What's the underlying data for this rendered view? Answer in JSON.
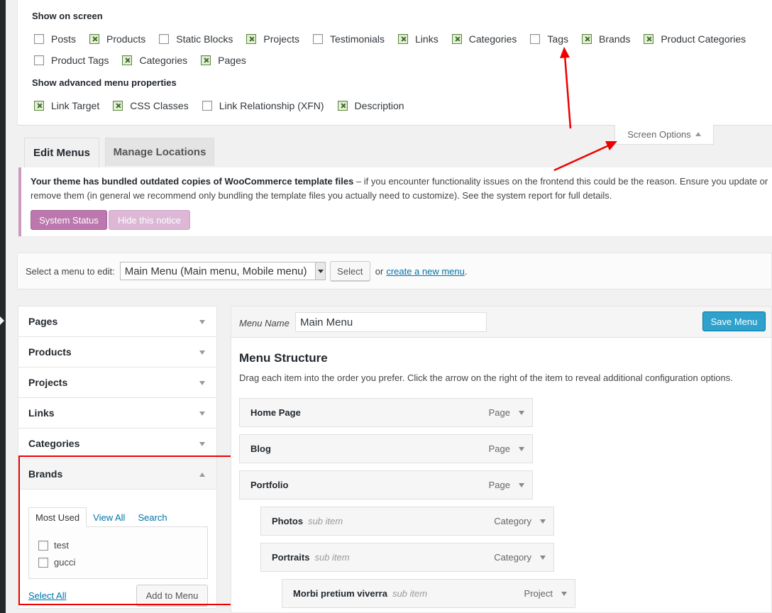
{
  "screen_options": {
    "show_on_screen_heading": "Show on screen",
    "items": [
      {
        "label": "Posts",
        "checked": false
      },
      {
        "label": "Products",
        "checked": true
      },
      {
        "label": "Static Blocks",
        "checked": false
      },
      {
        "label": "Projects",
        "checked": true
      },
      {
        "label": "Testimonials",
        "checked": false
      },
      {
        "label": "Links",
        "checked": true
      },
      {
        "label": "Categories",
        "checked": true
      },
      {
        "label": "Tags",
        "checked": false
      },
      {
        "label": "Brands",
        "checked": true
      },
      {
        "label": "Product Categories",
        "checked": true
      },
      {
        "label": "Product Tags",
        "checked": false
      },
      {
        "label": "Categories",
        "checked": true
      },
      {
        "label": "Pages",
        "checked": true
      }
    ],
    "advanced_heading": "Show advanced menu properties",
    "advanced_items": [
      {
        "label": "Link Target",
        "checked": true
      },
      {
        "label": "CSS Classes",
        "checked": true
      },
      {
        "label": "Link Relationship (XFN)",
        "checked": false
      },
      {
        "label": "Description",
        "checked": true
      }
    ],
    "tab_label": "Screen Options"
  },
  "nav_tabs": {
    "edit_menus": "Edit Menus",
    "manage_locations": "Manage Locations"
  },
  "notice": {
    "bold_text": "Your theme has bundled outdated copies of WooCommerce template files",
    "rest_text": " – if you encounter functionality issues on the frontend this could be the reason. Ensure you update or remove them (in general we recommend only bundling the template files you actually need to customize). See the system report for full details.",
    "system_status_button": "System Status",
    "hide_notice_button": "Hide this notice"
  },
  "manage_menus": {
    "label": "Select a menu to edit:",
    "selected_menu": "Main Menu (Main menu, Mobile menu)",
    "select_button": "Select",
    "or_text": "or",
    "create_link": "create a new menu",
    "period": "."
  },
  "accordion": {
    "sections": [
      "Pages",
      "Products",
      "Projects",
      "Links",
      "Categories"
    ],
    "brands": {
      "title": "Brands",
      "tabs": [
        "Most Used",
        "View All",
        "Search"
      ],
      "items": [
        "test",
        "gucci"
      ],
      "select_all": "Select All",
      "add_button": "Add to Menu"
    }
  },
  "editor": {
    "menu_name_label": "Menu Name",
    "menu_name_value": "Main Menu",
    "save_button": "Save Menu",
    "structure_title": "Menu Structure",
    "structure_desc": "Drag each item into the order you prefer. Click the arrow on the right of the item to reveal additional configuration options.",
    "items": [
      {
        "title": "Home Page",
        "sub": "",
        "type": "Page",
        "depth": 0
      },
      {
        "title": "Blog",
        "sub": "",
        "type": "Page",
        "depth": 0
      },
      {
        "title": "Portfolio",
        "sub": "",
        "type": "Page",
        "depth": 0
      },
      {
        "title": "Photos",
        "sub": "sub item",
        "type": "Category",
        "depth": 1
      },
      {
        "title": "Portraits",
        "sub": "sub item",
        "type": "Category",
        "depth": 1
      },
      {
        "title": "Morbi pretium viverra",
        "sub": "sub item",
        "type": "Project",
        "depth": 2
      }
    ]
  },
  "colors": {
    "annotation_red": "#ee0000",
    "primary_blue": "#2ea2cc",
    "woo_purple": "#bb77ae"
  }
}
